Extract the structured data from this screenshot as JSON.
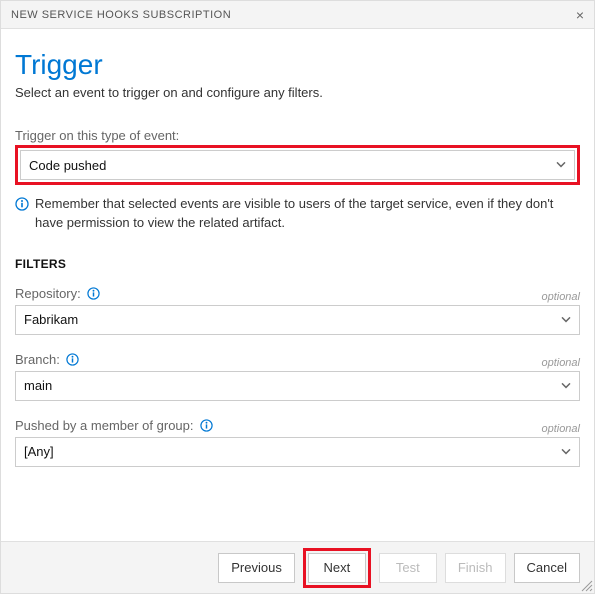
{
  "header": {
    "title": "NEW SERVICE HOOKS SUBSCRIPTION"
  },
  "page": {
    "title": "Trigger",
    "subtitle": "Select an event to trigger on and configure any filters."
  },
  "event": {
    "label": "Trigger on this type of event:",
    "value": "Code pushed",
    "info": "Remember that selected events are visible to users of the target service, even if they don't have permission to view the related artifact."
  },
  "filters": {
    "heading": "FILTERS",
    "optional_label": "optional",
    "repository": {
      "label": "Repository:",
      "value": "Fabrikam"
    },
    "branch": {
      "label": "Branch:",
      "value": "main"
    },
    "pushed_by": {
      "label": "Pushed by a member of group:",
      "value": "[Any]"
    }
  },
  "footer": {
    "previous": "Previous",
    "next": "Next",
    "test": "Test",
    "finish": "Finish",
    "cancel": "Cancel"
  }
}
